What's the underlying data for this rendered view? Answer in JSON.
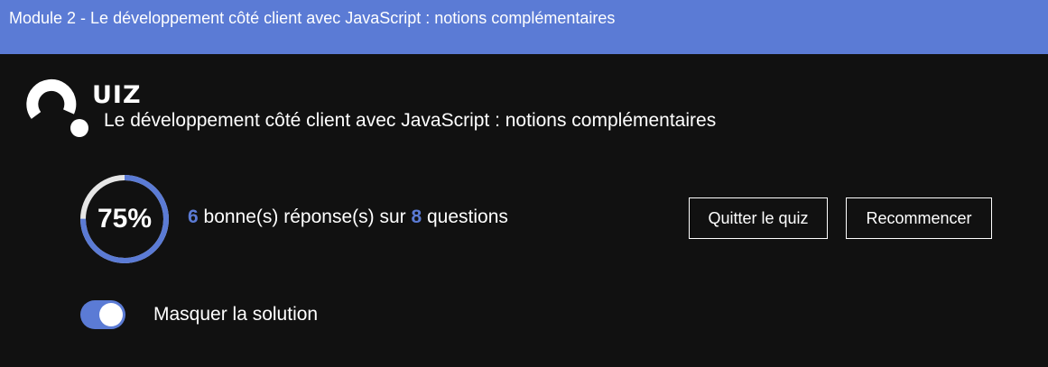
{
  "header": {
    "title": "Module 2 - Le développement côté client avec JavaScript : notions complémentaires"
  },
  "logo": {
    "word": "UIZ",
    "icon": "quiz-question-mark-icon"
  },
  "quiz": {
    "title": "Le développement côté client avec JavaScript : notions complémentaires"
  },
  "score": {
    "percent_label": "75%",
    "fraction": 0.75,
    "correct": "6",
    "total": "8",
    "text_mid": " bonne(s) réponse(s) sur ",
    "text_end": " questions"
  },
  "actions": {
    "quit_label": "Quitter le quiz",
    "restart_label": "Recommencer"
  },
  "solution_toggle": {
    "label": "Masquer la solution",
    "checked": true
  },
  "colors": {
    "accent": "#5b7bd5",
    "background": "#111111",
    "ring_track": "#e6e6e6"
  }
}
